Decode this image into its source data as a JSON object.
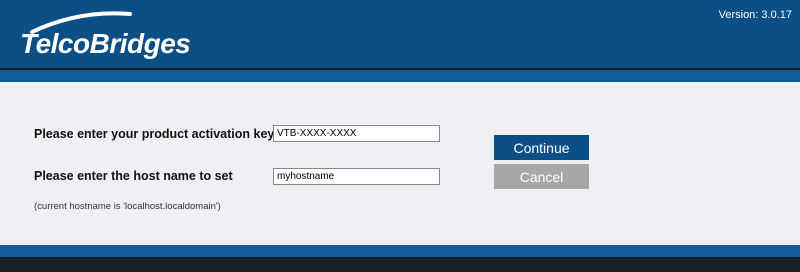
{
  "header": {
    "logo_text": "TelcoBridges",
    "version": "Version: 3.0.17"
  },
  "form": {
    "activation_key_label": "Please enter your product activation key",
    "activation_key_value": "VTB-XXXX-XXXX",
    "hostname_label": "Please enter the host name to set",
    "hostname_value": "myhostname",
    "current_hostname_note": "(current hostname is 'localhost.localdomain')"
  },
  "buttons": {
    "continue_label": "Continue",
    "cancel_label": "Cancel"
  },
  "colors": {
    "header_blue": "#0b4f86",
    "band_blue": "#0f5c98",
    "dark_bar": "#1b1f26",
    "page_background": "#eef0f4",
    "cancel_gray": "#a7a7a7"
  }
}
